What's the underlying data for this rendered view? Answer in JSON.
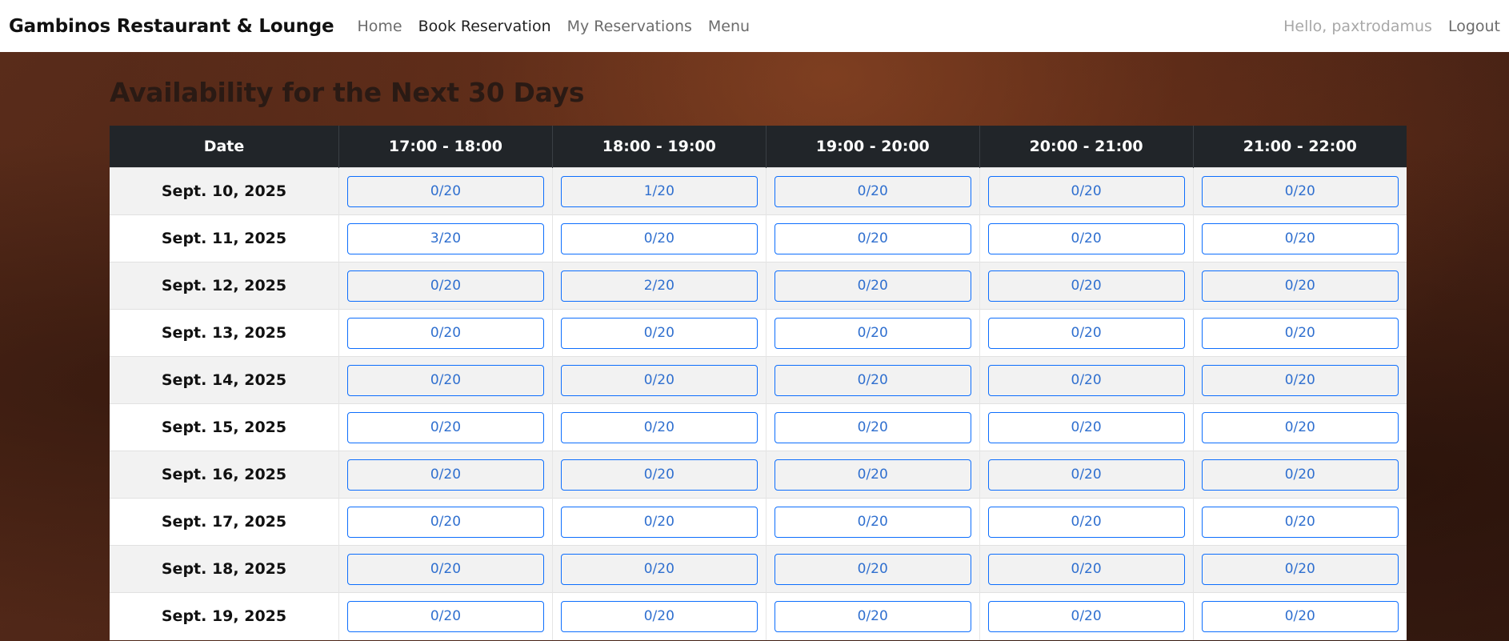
{
  "navbar": {
    "brand": "Gambinos Restaurant & Lounge",
    "links": [
      {
        "label": "Home",
        "active": false
      },
      {
        "label": "Book Reservation",
        "active": true
      },
      {
        "label": "My Reservations",
        "active": false
      },
      {
        "label": "Menu",
        "active": false
      }
    ],
    "greeting": "Hello, paxtrodamus",
    "logout_label": "Logout"
  },
  "page": {
    "heading": "Availability for the Next 30 Days"
  },
  "table": {
    "headers": [
      "Date",
      "17:00 - 18:00",
      "18:00 - 19:00",
      "19:00 - 20:00",
      "20:00 - 21:00",
      "21:00 - 22:00"
    ],
    "rows": [
      {
        "date": "Sept. 10, 2025",
        "slots": [
          "0/20",
          "1/20",
          "0/20",
          "0/20",
          "0/20"
        ]
      },
      {
        "date": "Sept. 11, 2025",
        "slots": [
          "3/20",
          "0/20",
          "0/20",
          "0/20",
          "0/20"
        ]
      },
      {
        "date": "Sept. 12, 2025",
        "slots": [
          "0/20",
          "2/20",
          "0/20",
          "0/20",
          "0/20"
        ]
      },
      {
        "date": "Sept. 13, 2025",
        "slots": [
          "0/20",
          "0/20",
          "0/20",
          "0/20",
          "0/20"
        ]
      },
      {
        "date": "Sept. 14, 2025",
        "slots": [
          "0/20",
          "0/20",
          "0/20",
          "0/20",
          "0/20"
        ]
      },
      {
        "date": "Sept. 15, 2025",
        "slots": [
          "0/20",
          "0/20",
          "0/20",
          "0/20",
          "0/20"
        ]
      },
      {
        "date": "Sept. 16, 2025",
        "slots": [
          "0/20",
          "0/20",
          "0/20",
          "0/20",
          "0/20"
        ]
      },
      {
        "date": "Sept. 17, 2025",
        "slots": [
          "0/20",
          "0/20",
          "0/20",
          "0/20",
          "0/20"
        ]
      },
      {
        "date": "Sept. 18, 2025",
        "slots": [
          "0/20",
          "0/20",
          "0/20",
          "0/20",
          "0/20"
        ]
      },
      {
        "date": "Sept. 19, 2025",
        "slots": [
          "0/20",
          "0/20",
          "0/20",
          "0/20",
          "0/20"
        ]
      }
    ]
  },
  "colors": {
    "navbar_bg": "#ffffff",
    "table_header_bg": "#212529",
    "slot_accent": "#0d6efd",
    "background": "#4a2518"
  }
}
